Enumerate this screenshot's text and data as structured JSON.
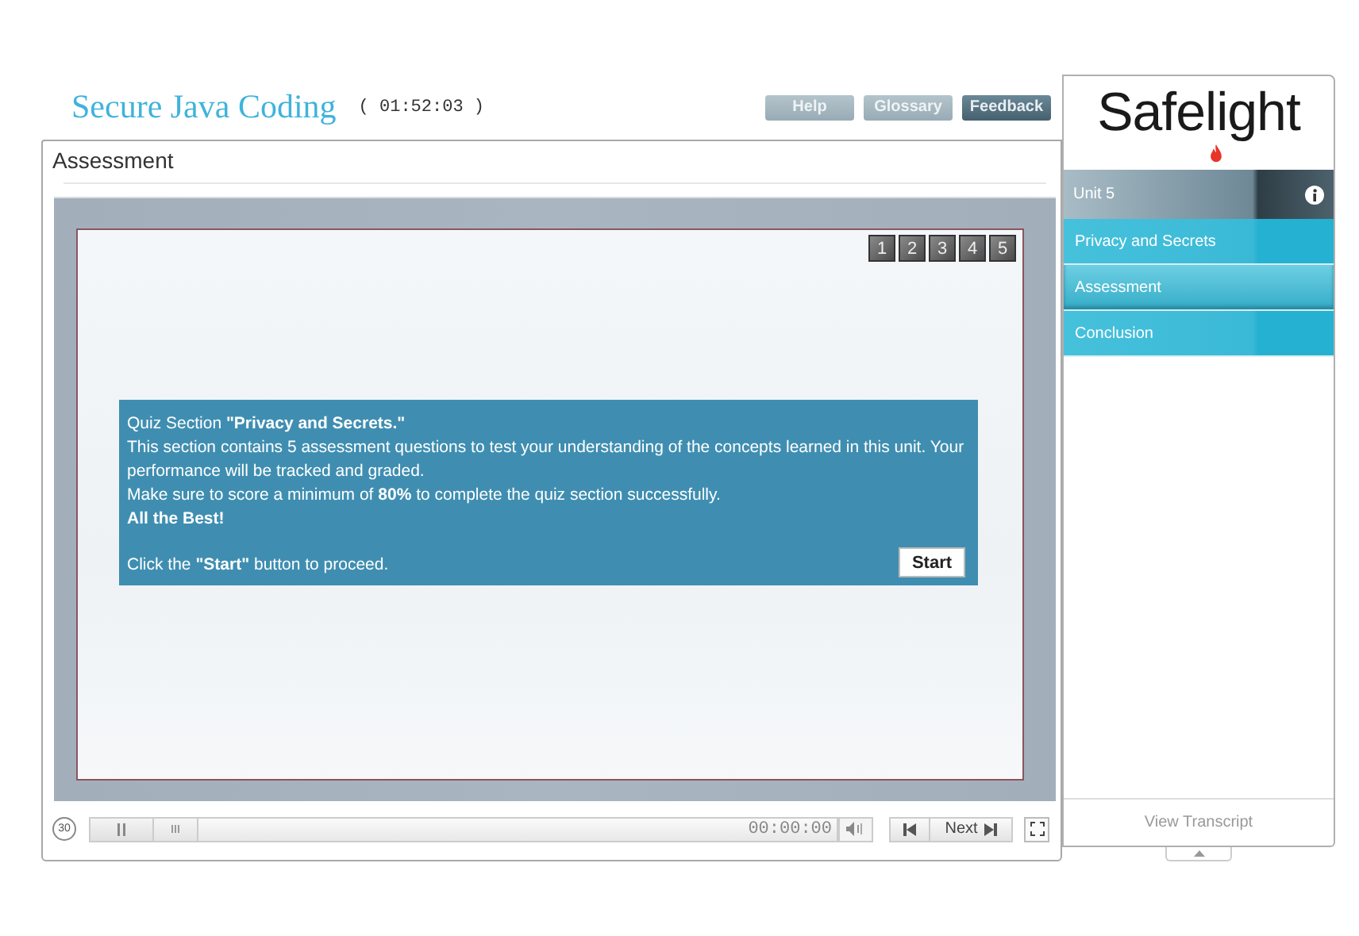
{
  "course": {
    "title": "Secure Java Coding",
    "timer": "( 01:52:03 )"
  },
  "header_buttons": [
    {
      "label": "Help",
      "disabled": true
    },
    {
      "label": "Glossary",
      "disabled": true
    },
    {
      "label": "Feedback",
      "disabled": false
    }
  ],
  "panel": {
    "title": "Assessment"
  },
  "question_numbers": [
    "1",
    "2",
    "3",
    "4",
    "5"
  ],
  "quiz_box": {
    "lines": [
      {
        "text": "Quiz Section **\"Privacy and Secrets.\"**",
        "bold": false
      },
      {
        "text": "This section contains 5 assessment questions to test your understanding of the concepts learned in this unit. Your performance will be tracked and graded.",
        "bold": false
      },
      {
        "text": "Make sure to score a minimum of **80%** to complete the quiz section successfully.",
        "bold": false
      },
      {
        "text": "All the Best!",
        "bold": true
      }
    ],
    "instruction": "Click the **\"Start\"** button to proceed.",
    "button": "Start"
  },
  "player": {
    "replay": "30",
    "level": 0,
    "time": "00:00:00",
    "next": "Next"
  },
  "sidebar": {
    "logo": "Safelight",
    "unit": "Unit 5",
    "items": [
      {
        "label": "Privacy and Secrets",
        "selected": false
      },
      {
        "label": "Assessment",
        "selected": true
      },
      {
        "label": "Conclusion",
        "selected": false
      }
    ],
    "transcript": "View Transcript"
  }
}
